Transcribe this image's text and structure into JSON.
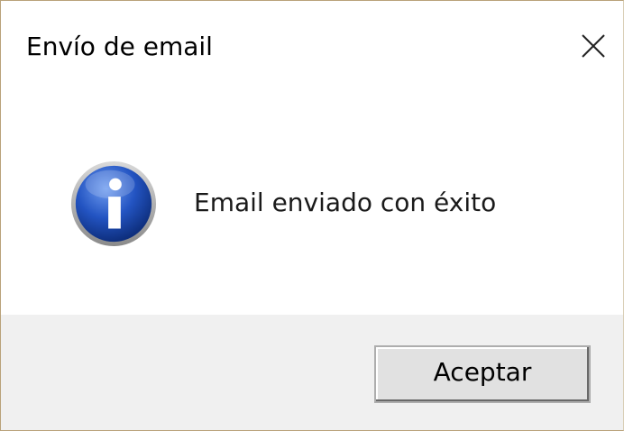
{
  "dialog": {
    "title": "Envío de email",
    "message": "Email enviado con éxito",
    "ok_label": "Aceptar"
  },
  "icons": {
    "close": "close-icon",
    "info": "info-icon"
  },
  "colors": {
    "icon_blue": "#1f4fb6",
    "footer_bg": "#f0f0f0",
    "border": "#b9a27a"
  }
}
